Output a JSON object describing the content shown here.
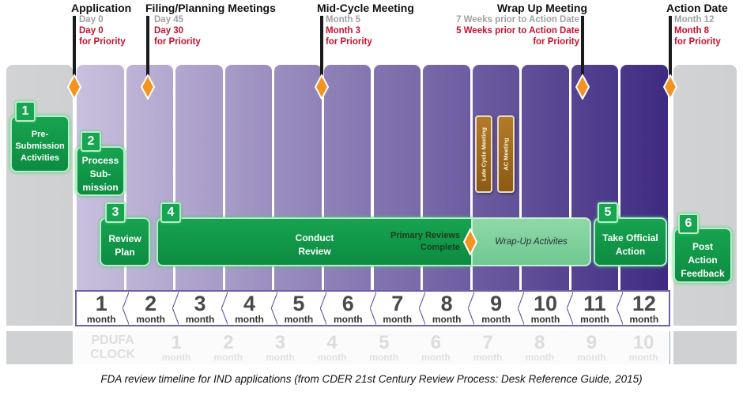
{
  "milestones": [
    {
      "title": "Application",
      "standard": "Day 0",
      "priority": "Day 0",
      "priority_suffix": "for Priority"
    },
    {
      "title": "Filing/Planning Meetings",
      "standard": "Day 45",
      "priority": "Day 30",
      "priority_suffix": "for Priority"
    },
    {
      "title": "Mid-Cycle Meeting",
      "standard": "Month 5",
      "priority": "Month 3",
      "priority_suffix": "for Priority"
    },
    {
      "title": "Wrap Up Meeting",
      "standard": "7 Weeks prior to Action Date",
      "priority": "5 Weeks prior to Action Date",
      "priority_suffix": "for Priority"
    },
    {
      "title": "Action Date",
      "standard": "Month 12",
      "priority": "Month 8",
      "priority_suffix": "for Priority"
    }
  ],
  "steps": [
    {
      "num": "1",
      "label": "Pre-\nSubmission\nActivities"
    },
    {
      "num": "2",
      "label": "Process\nSub-\nmission"
    },
    {
      "num": "3",
      "label": "Review\nPlan"
    },
    {
      "num": "4",
      "label": "Conduct\nReview"
    },
    {
      "num": "5",
      "label": "Take Official\nAction"
    },
    {
      "num": "6",
      "label": "Post\nAction\nFeedback"
    }
  ],
  "primary_reviews_label": "Primary Reviews\nComplete",
  "wrapup_activities_label": "Wrap-Up Activites",
  "vertical_bars": [
    "Late Cycle Meeting",
    "AC Meeting"
  ],
  "months": {
    "unit": "month",
    "values": [
      "1",
      "2",
      "3",
      "4",
      "5",
      "6",
      "7",
      "8",
      "9",
      "10",
      "11",
      "12"
    ]
  },
  "pdufa": {
    "label_line1": "PDUFA",
    "label_line2": "CLOCK",
    "unit": "month",
    "values": [
      "1",
      "2",
      "3",
      "4",
      "5",
      "6",
      "7",
      "8",
      "9",
      "10"
    ]
  },
  "colors": {
    "step_green": "#0c8c41",
    "milestone_diamond": "#f39321",
    "priority_red": "#c8102e",
    "month_col_start": "#c9c0de",
    "month_col_end": "#3f2a82"
  },
  "caption": "FDA review timeline for IND applications (from CDER 21st Century Review Process: Desk Reference Guide, 2015)"
}
